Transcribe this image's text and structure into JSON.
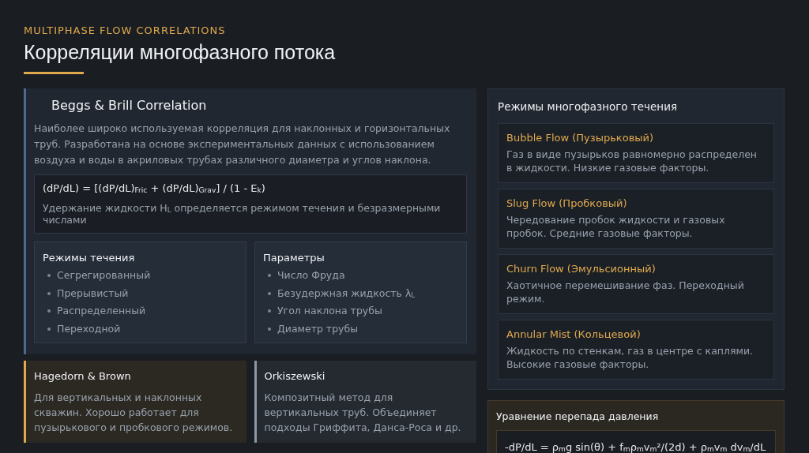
{
  "header": {
    "eyebrow": "MULTIPHASE FLOW CORRELATIONS",
    "title": "Корреляции многофазного потока"
  },
  "main_card": {
    "title": "Beggs & Brill Correlation",
    "description": "Наиболее широко используемая корреляция для наклонных и горизонтальных труб. Разработана на основе экспериментальных данных с использованием воздуха и воды в акриловых трубах различного диаметра и углов наклона.",
    "formula": {
      "equation": "(dP/dL) = [(dP/dL)$_{Fric}$ + (dP/dL)$_{Grav}$] / (1 - E$_{k}$)",
      "note": "Удержание жидкости H$_{L}$ определяется режимом течения и безразмерными числами"
    },
    "lists": [
      {
        "title": "Режимы течения",
        "items": [
          "Сегрегированный",
          "Прерывистый",
          "Распределенный",
          "Переходной"
        ]
      },
      {
        "title": "Параметры",
        "items": [
          "Число Фруда",
          "Безудержная жидкость λ$_{L}$",
          "Угол наклона трубы",
          "Диаметр трубы"
        ]
      }
    ]
  },
  "side_cards": [
    {
      "kind": "warm",
      "color": "#e0a94e",
      "title": "Hagedorn & Brown",
      "text": "Для вертикальных и наклонных скважин. Хорошо работает для пузырькового и пробкового режимов."
    },
    {
      "kind": "plain",
      "color": "#8c97a8",
      "title": "Orkiszewski",
      "text": "Композитный метод для вертикальных труб. Объединяет подходы Гриффита, Данса-Роса и др."
    }
  ],
  "regimes_panel": {
    "title": "Режимы многофазного течения",
    "regimes": [
      {
        "name": "Bubble Flow (Пузырьковый)",
        "description": "Газ в виде пузырьков равномерно распределен в жидкости. Низкие газовые факторы."
      },
      {
        "name": "Slug Flow (Пробковый)",
        "description": "Чередование пробок жидкости и газовых пробок. Средние газовые факторы."
      },
      {
        "name": "Churn Flow (Эмульсионный)",
        "description": "Хаотичное перемешивание фаз. Переходный режим."
      },
      {
        "name": "Annular Mist (Кольцевой)",
        "description": "Жидкость по стенкам, газ в центре с каплями. Высокие газовые факторы."
      }
    ]
  },
  "pressure_panel": {
    "title": "Уравнение перепада давления",
    "equation": "-dP/dL = ρ$_{m}$g sin(θ) + f$_{m}$ρ$_{m}$v$_{m}$²/(2d) + ρ$_{m}$v$_{m}$ dv$_{m}$/dL"
  }
}
